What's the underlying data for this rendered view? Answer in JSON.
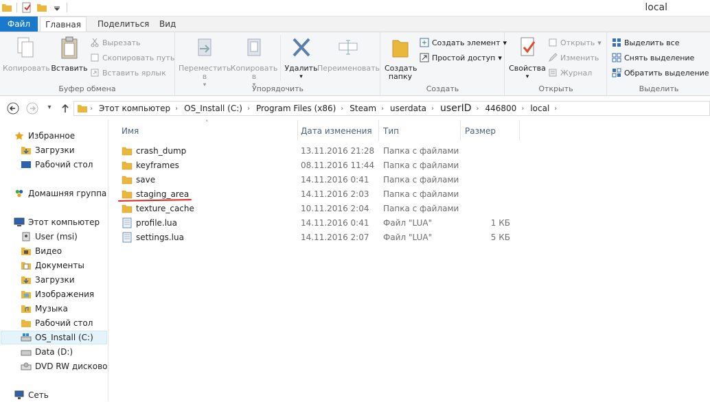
{
  "window": {
    "title": "local"
  },
  "tabs": [
    {
      "label": "Файл"
    },
    {
      "label": "Главная"
    },
    {
      "label": "Поделиться"
    },
    {
      "label": "Вид"
    }
  ],
  "ribbon": {
    "clipboard": {
      "label": "Буфер обмена",
      "copy": "Копировать",
      "paste": "Вставить",
      "cut": "Вырезать",
      "copy_path": "Скопировать путь",
      "paste_shortcut": "Вставить ярлык"
    },
    "organize": {
      "label": "Упорядочить",
      "move_to": "Переместить в",
      "copy_to": "Копировать в",
      "delete": "Удалить",
      "rename": "Переименовать"
    },
    "create": {
      "label": "Создать",
      "new_folder": "Создать папку",
      "new_item": "Создать элемент",
      "easy_access": "Простой доступ"
    },
    "open": {
      "label": "Открыть",
      "properties": "Свойства",
      "open": "Открыть",
      "edit": "Изменить",
      "history": "Журнал"
    },
    "select": {
      "label": "Выделить",
      "select_all": "Выделить все",
      "select_none": "Снять выделение",
      "invert": "Обратить выделение"
    }
  },
  "address": {
    "crumbs": [
      "Этот компьютер",
      "OS_Install (C:)",
      "Program Files (x86)",
      "Steam",
      "userdata",
      "userID",
      "446800",
      "local"
    ]
  },
  "nav": {
    "favorites": "Избранное",
    "fav_items": [
      "Загрузки",
      "Рабочий стол"
    ],
    "homegroup": "Домашняя группа",
    "computer": "Этот компьютер",
    "computer_items": [
      "User (msi)",
      "Видео",
      "Документы",
      "Загрузки",
      "Изображения",
      "Музыка",
      "Рабочий стол",
      "OS_Install (C:)",
      "Data (D:)",
      "DVD RW дисковод ("
    ],
    "network": "Сеть"
  },
  "columns": {
    "name": "Имя",
    "date": "Дата изменения",
    "type": "Тип",
    "size": "Размер"
  },
  "files": [
    {
      "name": "crash_dump",
      "date": "13.11.2016 21:28",
      "type": "Папка с файлами",
      "size": "",
      "kind": "folder"
    },
    {
      "name": "keyframes",
      "date": "08.11.2016 11:44",
      "type": "Папка с файлами",
      "size": "",
      "kind": "folder"
    },
    {
      "name": "save",
      "date": "14.11.2016 0:41",
      "type": "Папка с файлами",
      "size": "",
      "kind": "folder"
    },
    {
      "name": "staging_area",
      "date": "14.11.2016 2:03",
      "type": "Папка с файлами",
      "size": "",
      "kind": "folder"
    },
    {
      "name": "texture_cache",
      "date": "10.11.2016 2:04",
      "type": "Папка с файлами",
      "size": "",
      "kind": "folder"
    },
    {
      "name": "profile.lua",
      "date": "14.11.2016 0:41",
      "type": "Файл \"LUA\"",
      "size": "1 КБ",
      "kind": "file"
    },
    {
      "name": "settings.lua",
      "date": "14.11.2016 2:07",
      "type": "Файл \"LUA\"",
      "size": "5 КБ",
      "kind": "file"
    }
  ],
  "colors": {
    "accent": "#1979ca",
    "folder": "#e8b73b",
    "annotation": "#e0211b"
  }
}
